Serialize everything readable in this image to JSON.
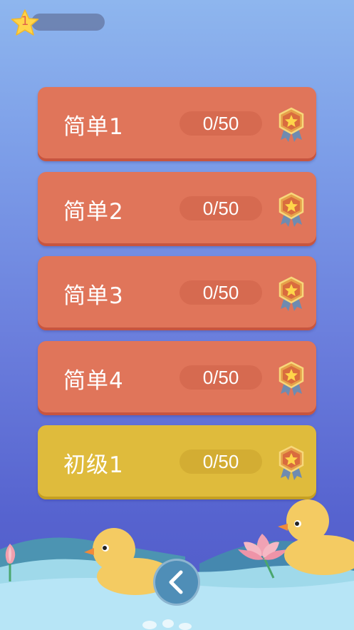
{
  "header": {
    "star_count": "1",
    "progress": 0
  },
  "levels": [
    {
      "name": "简单1",
      "progress": "0/50",
      "color": "orange"
    },
    {
      "name": "简单2",
      "progress": "0/50",
      "color": "orange"
    },
    {
      "name": "简单3",
      "progress": "0/50",
      "color": "orange"
    },
    {
      "name": "简单4",
      "progress": "0/50",
      "color": "orange"
    },
    {
      "name": "初级1",
      "progress": "0/50",
      "color": "yellow"
    }
  ],
  "colors": {
    "orange_card": "#e0755a",
    "yellow_card": "#dfbb3c",
    "star": "#ffd54a"
  },
  "icons": {
    "star": "star-icon",
    "medal": "medal-icon",
    "back": "back-arrow-icon"
  }
}
